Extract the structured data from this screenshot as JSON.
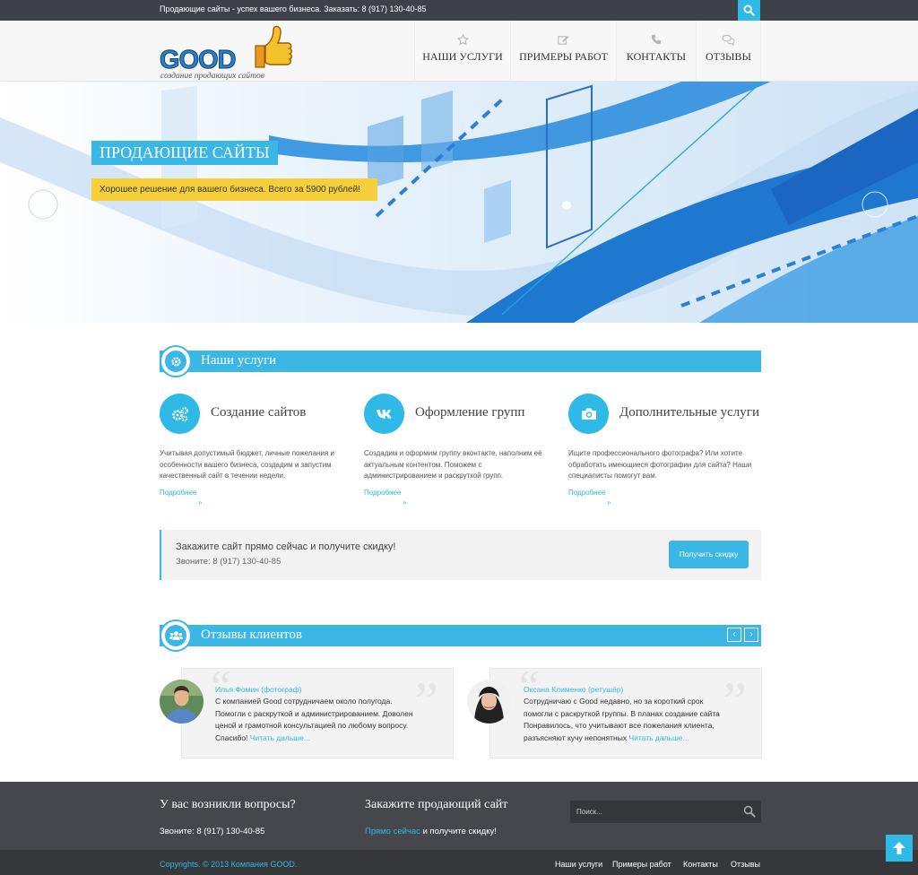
{
  "topbar": {
    "text": "Продающие сайты - успех вашего бизнеса. Заказать: 8 (917) 130-40-85",
    "search_icon": "search-icon"
  },
  "logo": {
    "brand": "GOOD",
    "tagline": "создание продающих сайтов"
  },
  "nav": [
    {
      "label": "НАШИ УСЛУГИ",
      "icon": "star-icon"
    },
    {
      "label": "ПРИМЕРЫ РАБОТ",
      "icon": "edit-icon"
    },
    {
      "label": "КОНТАКТЫ",
      "icon": "phone-icon"
    },
    {
      "label": "ОТЗЫВЫ",
      "icon": "comments-icon"
    }
  ],
  "hero": {
    "title": "ПРОДАЮЩИЕ САЙТЫ",
    "subtitle": "Хорошее решение для вашего бизнеса. Всего за 5900 рублей!"
  },
  "services": {
    "section_title": "Наши услуги",
    "items": [
      {
        "title": "Создание сайтов",
        "icon": "gears-icon",
        "desc": "Учитывая допустимый бюджет, личные пожелания и особенности вашего бизнеса, создадим и запустим качественный сайт в течении недели.",
        "more": "Подробнее",
        "arrow": "»"
      },
      {
        "title": "Оформление групп",
        "icon": "vk-icon",
        "desc": "Создадим и оформим группу вконтакте, наполним её актуальным контентом. Поможем с администрированием и раскруткой групп.",
        "more": "Подробнее",
        "arrow": "»"
      },
      {
        "title": "Дополнительные услуги",
        "icon": "camera-icon",
        "desc": "Ищите профессионального фотографа? Или хотите обработать имеющиеся фотографии для сайта? Наши специалисты помогут вам.",
        "more": "Подробнее",
        "arrow": "»"
      }
    ]
  },
  "cta": {
    "title": "Закажите сайт прямо сейчас и получите скидку!",
    "phone": "Звоните: 8 (917) 130-40-85",
    "button": "Получить скидку"
  },
  "reviews": {
    "section_title": "Отзывы клиентов",
    "prev": "‹",
    "next": "›",
    "items": [
      {
        "name": "Илья Фомин (фотограф)",
        "text": "С компанией Good сотрудничаем около полугода. Помогли с раскруткой и администрированием. Доволен ценой и грамотной консультацией по любому вопросу. Спасибо! ",
        "read_more": "Читать дальше..."
      },
      {
        "name": "Оксана Клименко (ретушёр)",
        "text": "Сотрудничаю с Good недавно, но за короткий срок помогли с раскруткой группы. В планах создание сайта Понравилось, что учитывают все пожелания клиента, разъясняют кучу непонятных ",
        "read_more": "Читать дальше..."
      }
    ]
  },
  "footer": {
    "questions_title": "У вас возникли вопросы?",
    "questions_phone": "Звоните: 8 (917) 130-40-85",
    "order_title": "Закажите продающий сайт",
    "order_link": "Прямо сейчас",
    "order_rest": " и получите скидку!",
    "search_placeholder": "Поиск...",
    "copyright": "Copyrights. © 2013 Компания GOOD.",
    "links": [
      "Наши услуги",
      "Примеры работ",
      "Контакты",
      "Отзывы"
    ]
  },
  "colors": {
    "accent": "#3ab7e4",
    "yellow": "#f6cf3a",
    "dark": "#45474c"
  }
}
